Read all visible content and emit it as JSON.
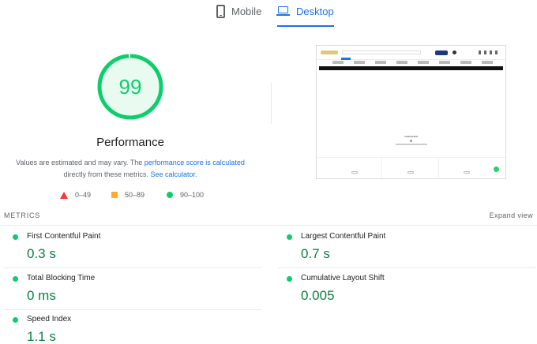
{
  "tabs": [
    {
      "label": "Mobile",
      "icon": "phone-icon",
      "active": false
    },
    {
      "label": "Desktop",
      "icon": "laptop-icon",
      "active": true
    }
  ],
  "score": {
    "value": "99",
    "fraction": 0.99,
    "title": "Performance",
    "color": "#0cce6b",
    "note_prefix": "Values are estimated and may vary. The ",
    "note_link1": "performance score is calculated",
    "note_middle": " directly from these metrics. ",
    "note_link2": "See calculator",
    "note_suffix": "."
  },
  "legend": [
    {
      "shape": "triangle",
      "range": "0–49",
      "color": "#ff3333"
    },
    {
      "shape": "square",
      "range": "50–89",
      "color": "#ffaa33"
    },
    {
      "shape": "circle",
      "range": "90–100",
      "color": "#0cce6b"
    }
  ],
  "preview": {
    "loading_text": "CARGANDO"
  },
  "metrics": {
    "title": "METRICS",
    "expand": "Expand view",
    "items": [
      {
        "label": "First Contentful Paint",
        "value": "0.3 s"
      },
      {
        "label": "Largest Contentful Paint",
        "value": "0.7 s"
      },
      {
        "label": "Total Blocking Time",
        "value": "0 ms"
      },
      {
        "label": "Cumulative Layout Shift",
        "value": "0.005"
      },
      {
        "label": "Speed Index",
        "value": "1.1 s"
      }
    ]
  }
}
